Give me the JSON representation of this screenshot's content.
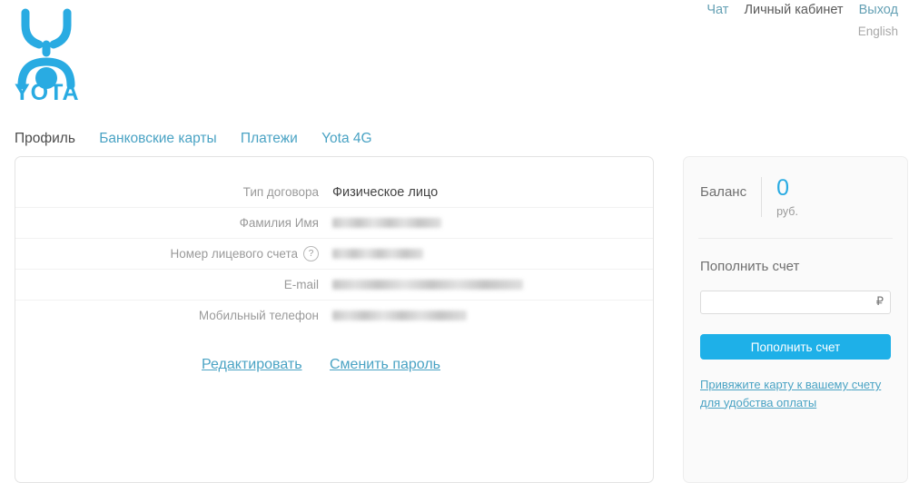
{
  "topnav": {
    "chat": "Чат",
    "account": "Личный кабинет",
    "logout": "Выход",
    "language": "English"
  },
  "logo": {
    "wordmark": "YOTA",
    "icon": "yota-figure-icon",
    "color": "#29abe2"
  },
  "tabs": [
    {
      "label": "Профиль",
      "active": true
    },
    {
      "label": "Банковские карты",
      "active": false
    },
    {
      "label": "Платежи",
      "active": false
    },
    {
      "label": "Yota 4G",
      "active": false
    }
  ],
  "profile": {
    "rows": [
      {
        "label": "Тип договора",
        "value": "Физическое лицо",
        "redacted": false
      },
      {
        "label": "Фамилия Имя",
        "value": "",
        "redacted": true
      },
      {
        "label": "Номер лицевого счета",
        "value": "",
        "redacted": true,
        "help": "?"
      },
      {
        "label": "E-mail",
        "value": "",
        "redacted": true
      },
      {
        "label": "Мобильный телефон",
        "value": "",
        "redacted": true
      }
    ],
    "actions": [
      {
        "label": "Редактировать"
      },
      {
        "label": "Сменить пароль"
      }
    ]
  },
  "sidebar": {
    "balance_label": "Баланс",
    "balance_amount": "0",
    "balance_unit": "руб.",
    "topup_title": "Пополнить счет",
    "topup_value": "",
    "topup_placeholder": "",
    "currency_symbol": "₽",
    "topup_button": "Пополнить счет",
    "note_line1": "Привяжите карту к вашему",
    "note_line2": "счету для удобства оплаты",
    "accent_color": "#1eb0e8"
  }
}
